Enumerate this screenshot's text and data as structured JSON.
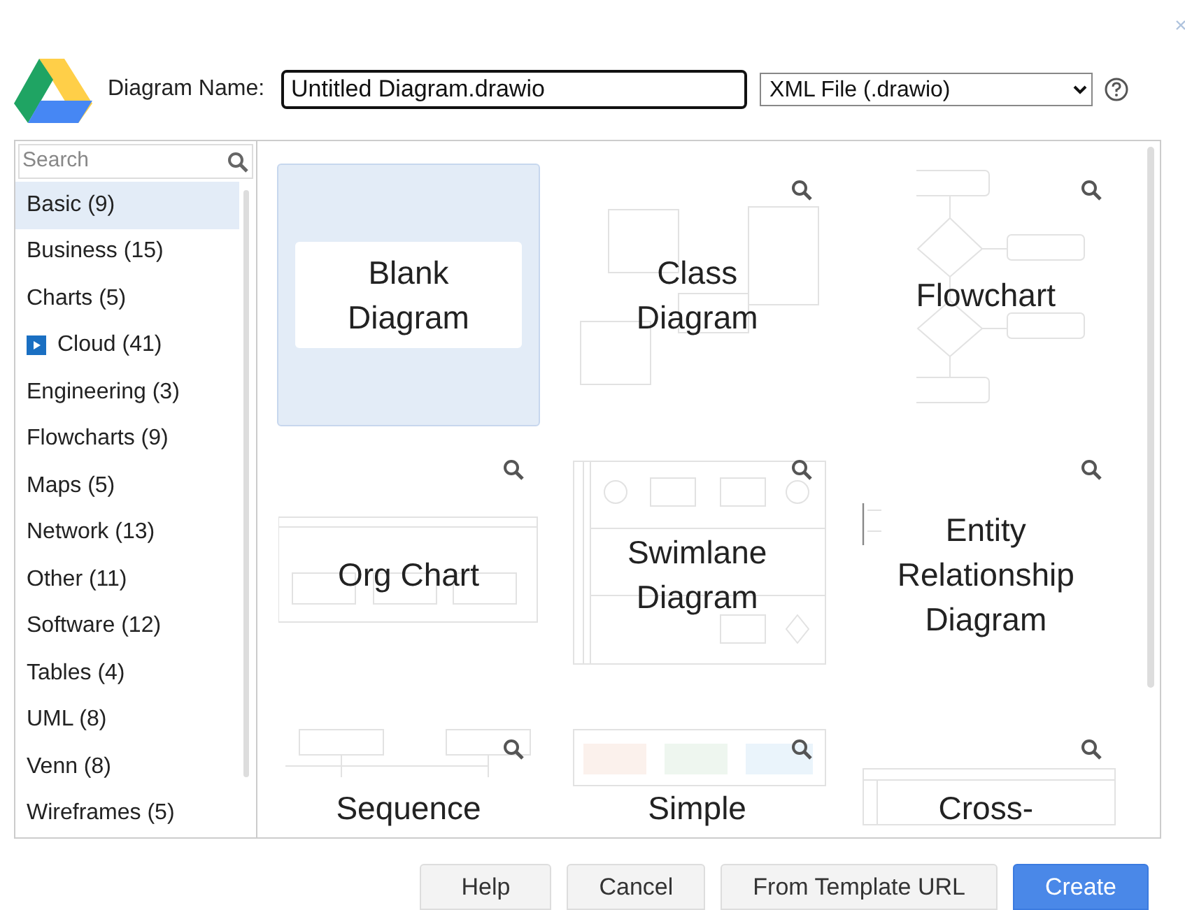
{
  "header": {
    "label": "Diagram Name:",
    "name_value": "Untitled Diagram.drawio",
    "format": "XML File (.drawio)"
  },
  "search": {
    "placeholder": "Search"
  },
  "categories": [
    {
      "label": "Basic (9)",
      "selected": true,
      "kind": "plain"
    },
    {
      "label": "Business (15)",
      "selected": false,
      "kind": "plain"
    },
    {
      "label": "Charts (5)",
      "selected": false,
      "kind": "plain"
    },
    {
      "label": "Cloud (41)",
      "selected": false,
      "kind": "expandable"
    },
    {
      "label": "Engineering (3)",
      "selected": false,
      "kind": "plain"
    },
    {
      "label": "Flowcharts (9)",
      "selected": false,
      "kind": "plain"
    },
    {
      "label": "Maps (5)",
      "selected": false,
      "kind": "plain"
    },
    {
      "label": "Network (13)",
      "selected": false,
      "kind": "plain"
    },
    {
      "label": "Other (11)",
      "selected": false,
      "kind": "plain"
    },
    {
      "label": "Software (12)",
      "selected": false,
      "kind": "plain"
    },
    {
      "label": "Tables (4)",
      "selected": false,
      "kind": "plain"
    },
    {
      "label": "UML (8)",
      "selected": false,
      "kind": "plain"
    },
    {
      "label": "Venn (8)",
      "selected": false,
      "kind": "plain"
    },
    {
      "label": "Wireframes (5)",
      "selected": false,
      "kind": "plain"
    }
  ],
  "templates": [
    {
      "label": "Blank Diagram",
      "selected": true,
      "kind": "blank"
    },
    {
      "label": "Class Diagram",
      "selected": false,
      "kind": "class"
    },
    {
      "label": "Flowchart",
      "selected": false,
      "kind": "flow"
    },
    {
      "label": "Org Chart",
      "selected": false,
      "kind": "org"
    },
    {
      "label": "Swimlane Diagram",
      "selected": false,
      "kind": "swimlane"
    },
    {
      "label": "Entity Relationship Diagram",
      "selected": false,
      "kind": "er"
    },
    {
      "label": "Sequence",
      "selected": false,
      "kind": "sequence"
    },
    {
      "label": "Simple",
      "selected": false,
      "kind": "kanban"
    },
    {
      "label": "Cross-",
      "selected": false,
      "kind": "cross"
    }
  ],
  "buttons": [
    {
      "label": "Help",
      "kind": "secondary"
    },
    {
      "label": "Cancel",
      "kind": "secondary"
    },
    {
      "label": "From Template URL",
      "kind": "secondary"
    },
    {
      "label": "Create",
      "kind": "primary"
    }
  ]
}
